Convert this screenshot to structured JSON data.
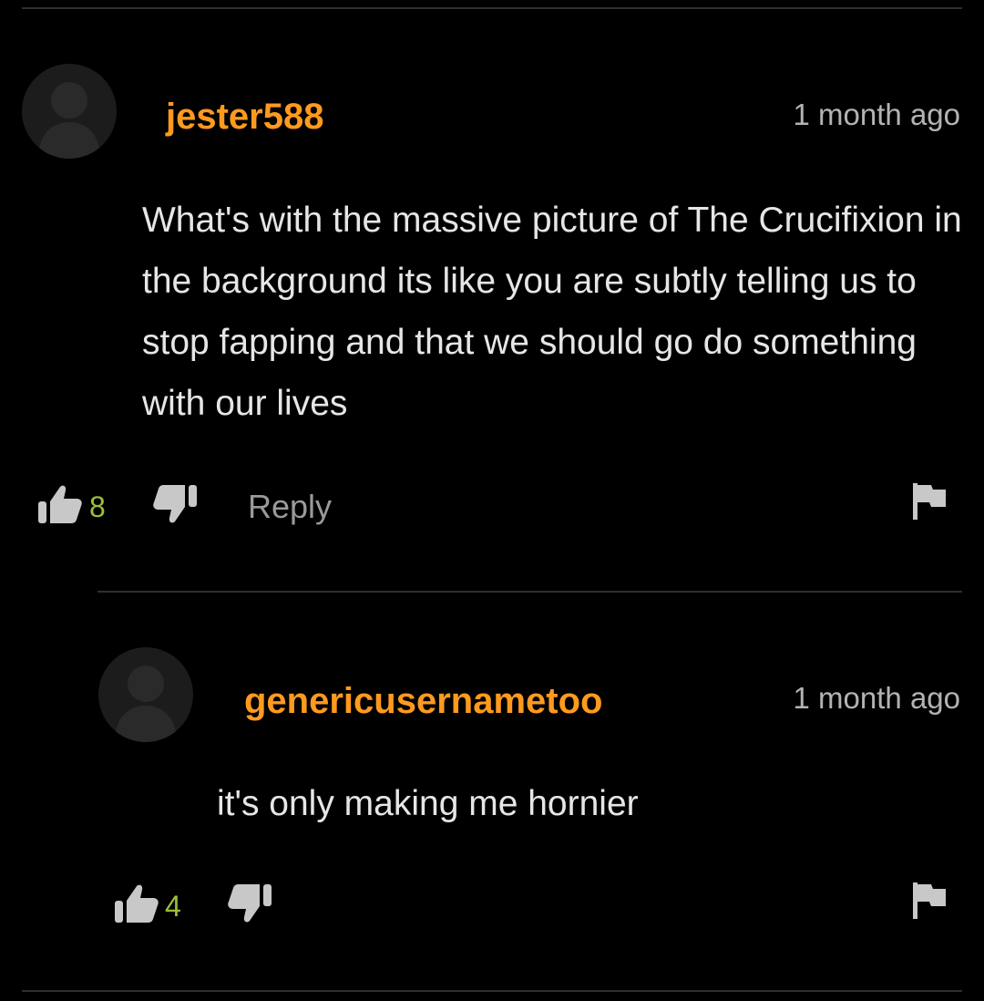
{
  "comments": [
    {
      "username": "jester588",
      "timestamp": "1 month ago",
      "text": "What's with the massive picture of The Crucifixion in the background its like you are subtly telling us to stop fapping and that we should go do something with our lives",
      "likes": "8",
      "reply_label": "Reply"
    },
    {
      "username": "genericusernametoo",
      "timestamp": "1 month ago",
      "text": "it's only making me hornier",
      "likes": "4"
    }
  ],
  "icons": {
    "avatar": "user-silhouette-icon",
    "like": "thumbs-up-icon",
    "dislike": "thumbs-down-icon",
    "report": "flag-icon"
  },
  "colors": {
    "background": "#000000",
    "username": "#ff9a1f",
    "like_count": "#9bbf3a",
    "body_text": "#e6e6e6",
    "muted_text": "#b3b3b3",
    "icon": "#c8c8c8",
    "divider": "#2f2f2f"
  }
}
